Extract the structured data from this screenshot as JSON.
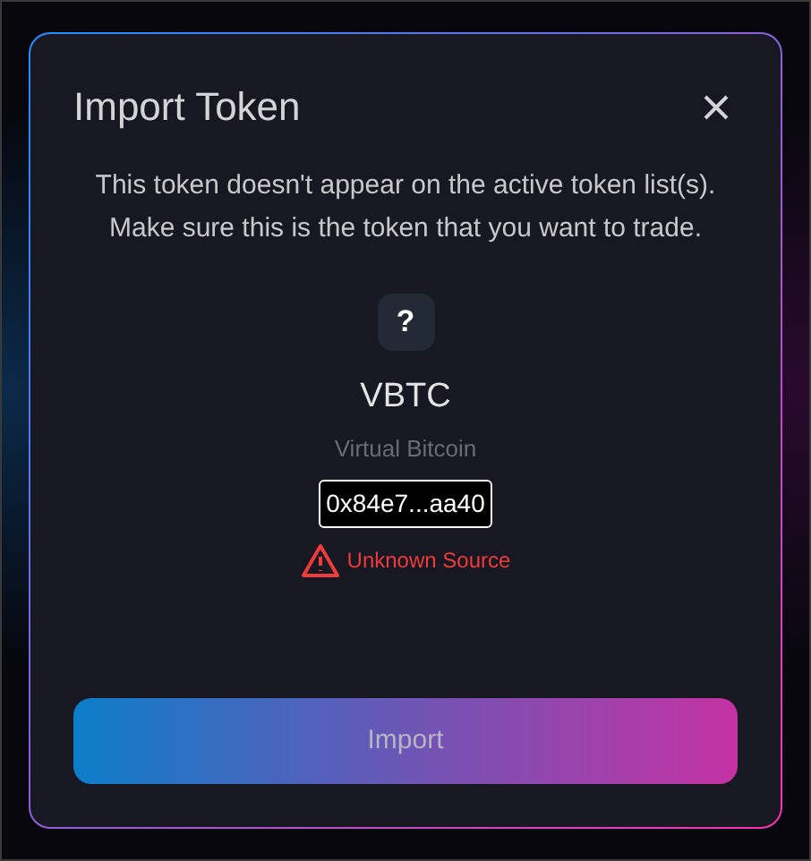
{
  "dialog": {
    "title": "Import Token",
    "message": "This token doesn't appear on the active token list(s). Make sure this is the token that you want to trade.",
    "token": {
      "icon_text": "?",
      "symbol": "VBTC",
      "name": "Virtual Bitcoin",
      "address": "0x84e7...aa40"
    },
    "warning": "Unknown Source",
    "button": "Import"
  }
}
